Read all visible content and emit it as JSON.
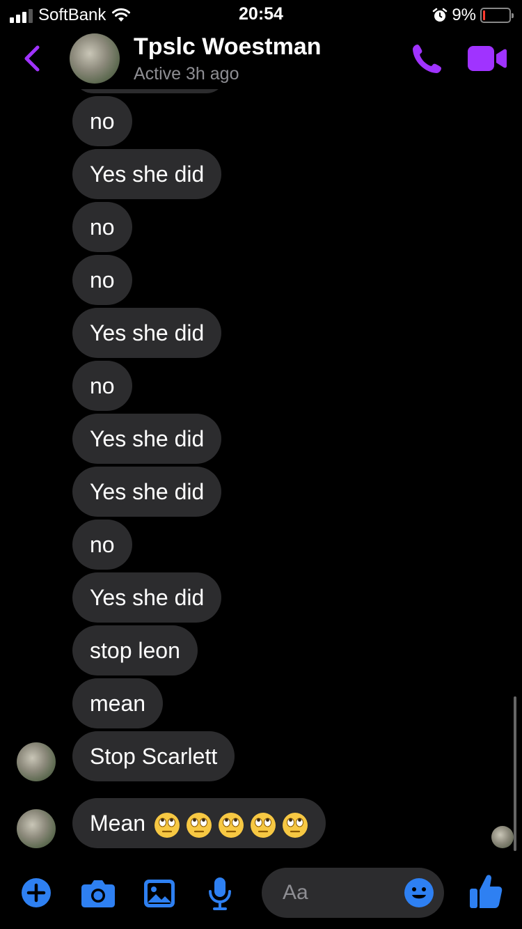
{
  "status_bar": {
    "carrier": "SoftBank",
    "time": "20:54",
    "battery_percent": "9%",
    "battery_level": 0.09,
    "battery_color": "#ff3b30"
  },
  "header": {
    "contact_name": "Tpslc Woestman",
    "contact_status": "Active 3h ago",
    "accent_color": "#a033ff",
    "icons": [
      "chevron-left-icon",
      "phone-icon",
      "video-camera-icon"
    ]
  },
  "messages": [
    {
      "text": "no"
    },
    {
      "text": "Yes she did"
    },
    {
      "text": "no"
    },
    {
      "text": "no"
    },
    {
      "text": "Yes she did"
    },
    {
      "text": "no"
    },
    {
      "text": "Yes she did"
    },
    {
      "text": "Yes she did"
    },
    {
      "text": "no"
    },
    {
      "text": "Yes she did"
    },
    {
      "text": "stop leon"
    },
    {
      "text": "mean"
    },
    {
      "text": "Stop Scarlett"
    },
    {
      "text": "Mean"
    }
  ],
  "last_message_emoji": [
    "face-with-rolling-eyes",
    "face-with-rolling-eyes",
    "face-with-rolling-eyes",
    "face-with-rolling-eyes",
    "face-with-rolling-eyes"
  ],
  "composer": {
    "placeholder": "Aa",
    "icon_color": "#2e80f2",
    "icons": [
      "plus-icon",
      "camera-icon",
      "photo-icon",
      "microphone-icon",
      "emoji-icon",
      "thumbs-up-icon"
    ]
  }
}
